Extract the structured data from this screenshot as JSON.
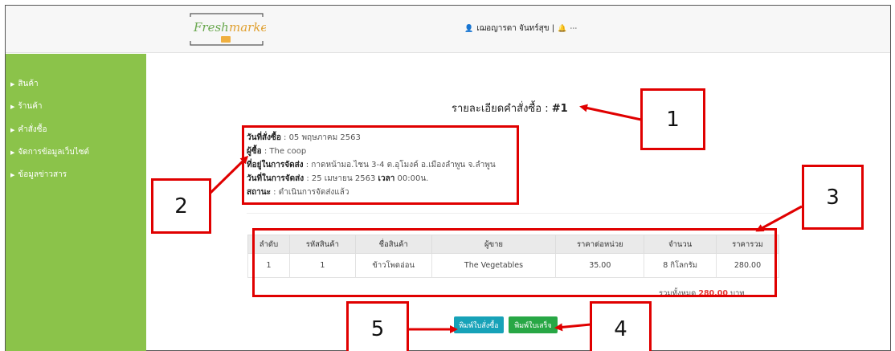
{
  "header": {
    "logo_text": "Fresh market",
    "user_name": "เฌอญารดา จันทร์สุข |"
  },
  "sidebar": {
    "items": [
      {
        "label": "สินค้า"
      },
      {
        "label": "ร้านค้า"
      },
      {
        "label": "คำสั่งซื้อ"
      },
      {
        "label": "จัดการข้อมูลเว็บไซต์"
      },
      {
        "label": "ข้อมูลข่าวสาร"
      }
    ]
  },
  "main": {
    "title_label": "รายละเอียดคำสั่งซื้อ :",
    "order_no": "#1",
    "info": {
      "order_date_label": "วันที่สั่งซื้อ",
      "order_date": ": 05 พฤษภาคม 2563",
      "buyer_label": "ผู้ซื้อ",
      "buyer": ": The coop",
      "address_label": "ที่อยู่ในการจัดส่ง",
      "address": ": กาดหน้ามอ.ไชน 3-4 ต.อุโมงค์ อ.เมืองลำพูน จ.ลำพูน",
      "delivery_label": "วันที่ในการจัดส่ง",
      "delivery_date": ": 25 เมษายน 2563",
      "time_label": "เวลา",
      "time": "00:00น.",
      "status_label": "สถานะ",
      "status": ": ดำเนินการจัดส่งแล้ว"
    },
    "table": {
      "headers": [
        "ลำดับ",
        "รหัสสินค้า",
        "ชื่อสินค้า",
        "ผู้ขาย",
        "ราคาต่อหน่วย",
        "จำนวน",
        "ราคารวม"
      ],
      "rows": [
        [
          "1",
          "1",
          "ข้าวโพดอ่อน",
          "The Vegetables",
          "35.00",
          "8 กิโลกรัม",
          "280.00"
        ]
      ]
    },
    "total_label": "รวมทั้งหมด",
    "total_amount": "280.00",
    "total_unit": "บาท",
    "buttons": {
      "print_order": "พิมพ์ใบสั่งซื้อ",
      "print_receipt": "พิมพ์ใบเสร็จ"
    }
  },
  "annotations": {
    "c1": "1",
    "c2": "2",
    "c3": "3",
    "c4": "4",
    "c5": "5",
    "color": "#e00000"
  },
  "colors": {
    "sidebar": "#8bc34a",
    "btn_order": "#17a2b8",
    "btn_receipt": "#28a745"
  }
}
